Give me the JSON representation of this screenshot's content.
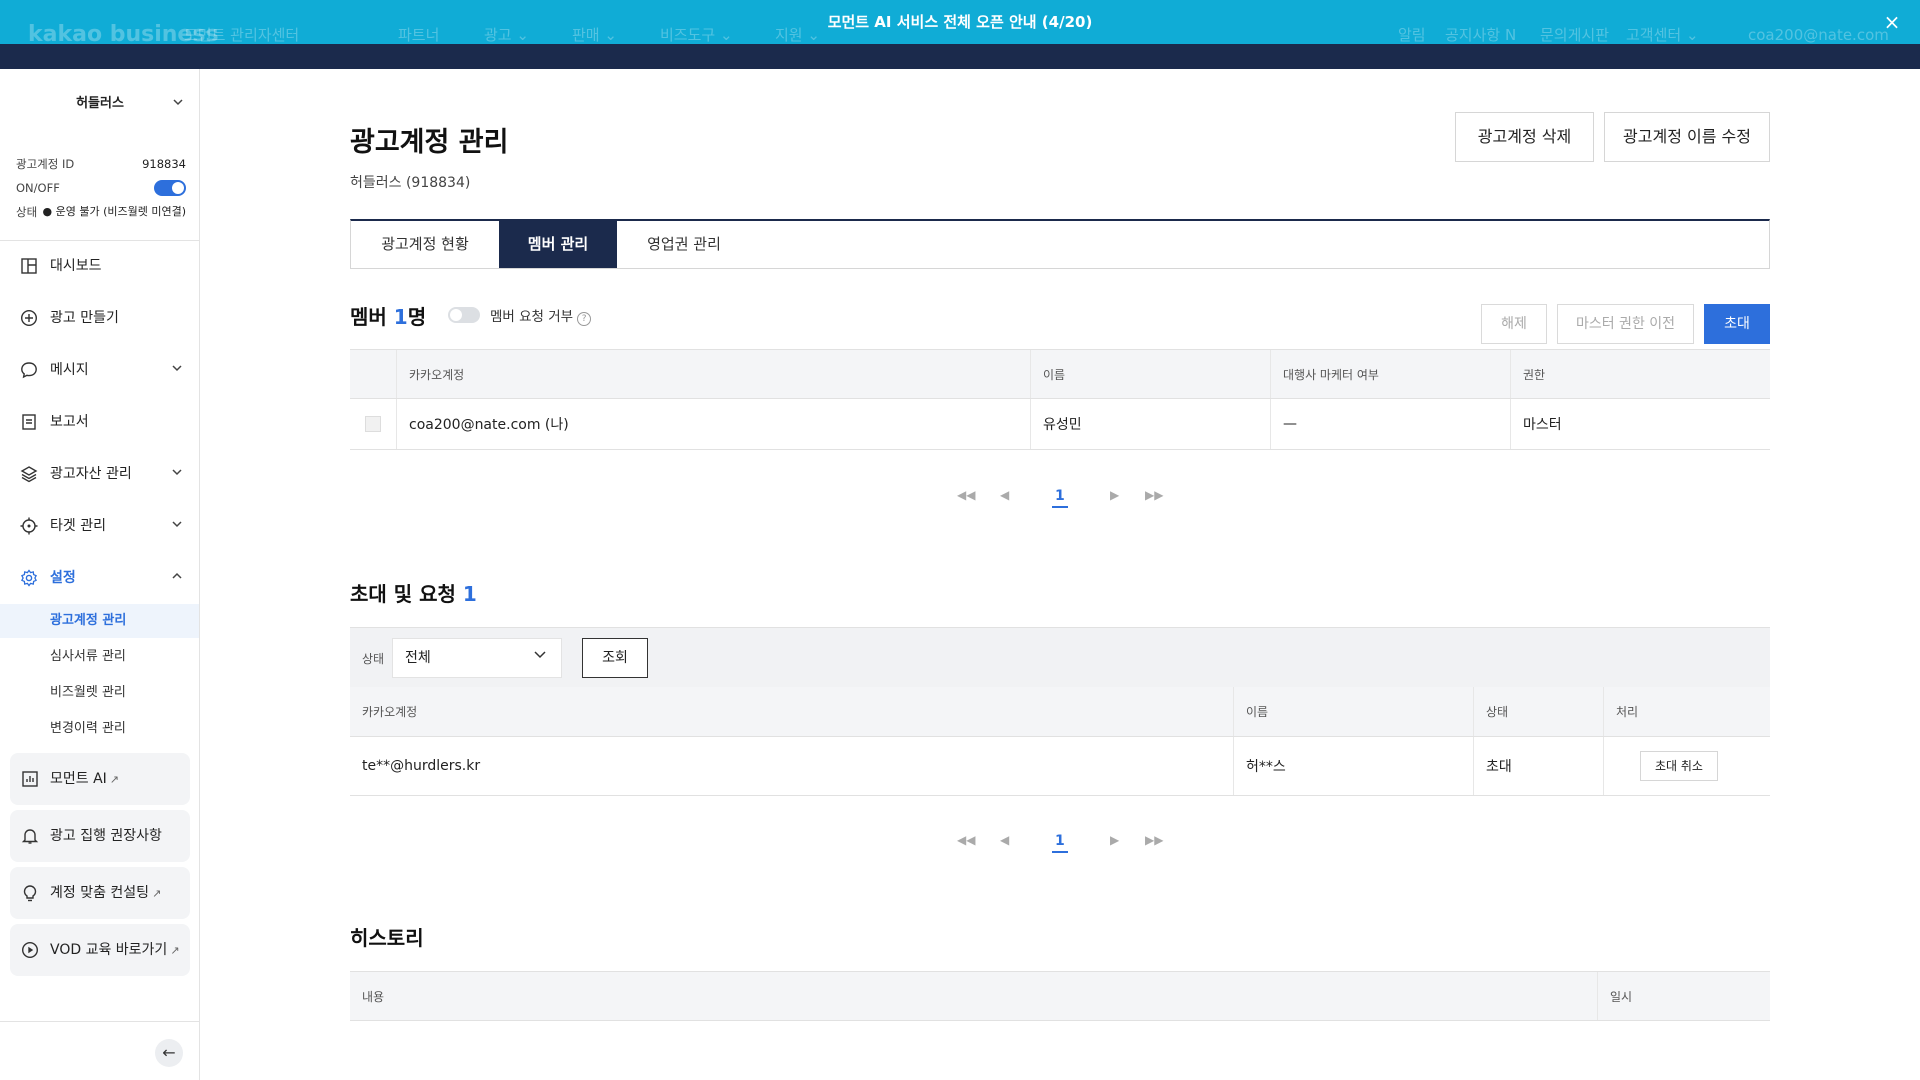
{
  "banner": {
    "message": "모먼트 AI 서비스 전체 오픈 안내 (4/20)",
    "close_icon": "×",
    "logo_text": "kakao business",
    "center_text": "모먼트 관리자센터",
    "nav": [
      "파트너",
      "광고 ⌄",
      "판매 ⌄",
      "비즈도구 ⌄",
      "지원 ⌄"
    ],
    "right": [
      "알림",
      "공지사항 N",
      "문의게시판",
      "고객센터 ⌄",
      "coa200@nate.com"
    ]
  },
  "sidebar": {
    "account_name": "허들러스",
    "account_id_label": "광고계정 ID",
    "account_id": "918834",
    "onoff_label": "ON/OFF",
    "status_label": "상태",
    "status_value": "● 운영 불가 (비즈월렛 미연결)",
    "items": [
      {
        "label": "대시보드",
        "icon": "dashboard-icon"
      },
      {
        "label": "광고 만들기",
        "icon": "plus-circle-icon"
      },
      {
        "label": "메시지",
        "icon": "chat-icon"
      },
      {
        "label": "보고서",
        "icon": "report-icon"
      },
      {
        "label": "광고자산 관리",
        "icon": "layers-icon"
      },
      {
        "label": "타겟 관리",
        "icon": "target-icon"
      },
      {
        "label": "설정",
        "icon": "gear-icon"
      }
    ],
    "sub_items": [
      "광고계정 관리",
      "심사서류 관리",
      "비즈월렛 관리",
      "변경이력 관리"
    ],
    "cards": [
      {
        "label": "모먼트 AI",
        "icon": "chart-icon"
      },
      {
        "label": "광고 집행 권장사항",
        "icon": "bell-icon"
      },
      {
        "label": "계정 맞춤 컨설팅",
        "icon": "bulb-icon"
      },
      {
        "label": "VOD 교육 바로가기",
        "icon": "play-icon"
      }
    ],
    "collapse_icon": "←"
  },
  "main": {
    "title": "광고계정 관리",
    "subtitle": "허들러스 (918834)",
    "delete_button": "광고계정 삭제",
    "rename_button": "광고계정 이름 수정",
    "tabs": [
      "광고계정 현황",
      "멤버 관리",
      "영업권 관리"
    ],
    "members": {
      "title": "멤버",
      "count": "1",
      "count_suffix": "명",
      "toggle_label": "멤버 요청 거부",
      "help_icon": "?",
      "buttons": {
        "release": "해제",
        "transfer": "마스터 권한 이전",
        "invite": "초대"
      },
      "columns": [
        "카카오계정",
        "이름",
        "대행사 마케터 여부",
        "권한"
      ],
      "rows": [
        {
          "account": "coa200@nate.com (나)",
          "name": "유성민",
          "agency": "—",
          "role": "마스터"
        }
      ],
      "page": "1"
    },
    "invites": {
      "title": "초대 및 요청",
      "count": "1",
      "filter_label": "상태",
      "filter_value": "전체",
      "query_button": "조회",
      "columns": [
        "카카오계정",
        "이름",
        "상태",
        "처리"
      ],
      "rows": [
        {
          "account": "te**@hurdlers.kr",
          "name": "허**스",
          "status": "초대",
          "action": "초대 취소"
        }
      ],
      "page": "1"
    },
    "history": {
      "title": "히스토리",
      "columns": [
        "내용",
        "일시"
      ]
    },
    "pager_icons": {
      "first": "◀◀",
      "prev": "◀",
      "next": "▶",
      "last": "▶▶"
    }
  }
}
